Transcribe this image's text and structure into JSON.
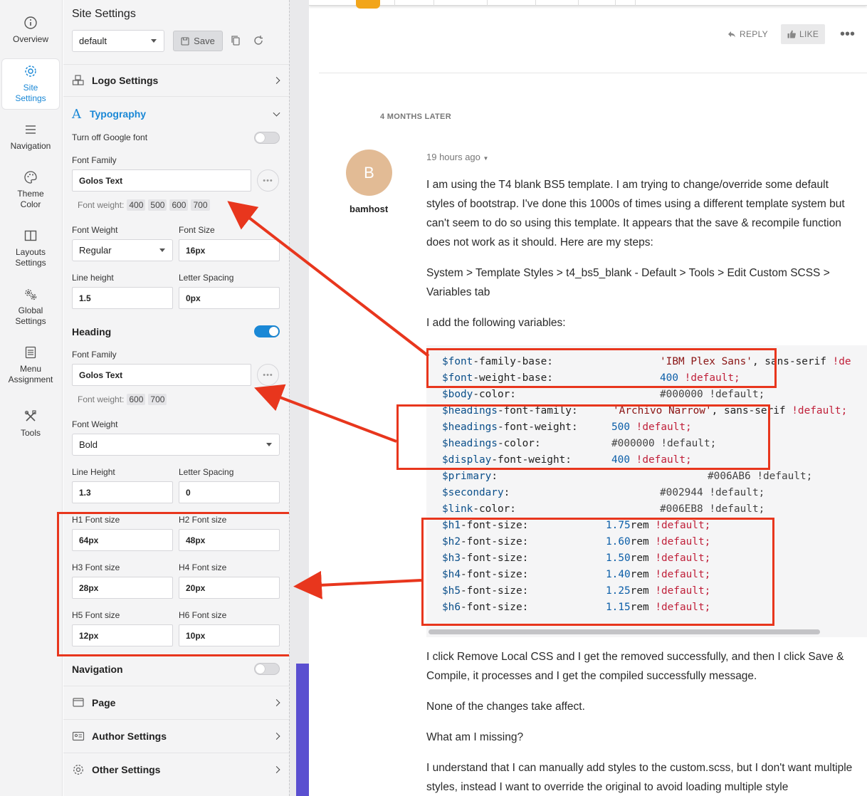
{
  "rail": {
    "items": [
      {
        "label": "Overview",
        "icon": "info-icon"
      },
      {
        "label": "Site\nSettings",
        "icon": "gear-icon"
      },
      {
        "label": "Navigation",
        "icon": "menu-icon"
      },
      {
        "label": "Theme\nColor",
        "icon": "palette-icon"
      },
      {
        "label": "Layouts\nSettings",
        "icon": "layout-icon"
      },
      {
        "label": "Global\nSettings",
        "icon": "gears-icon"
      },
      {
        "label": "Menu\nAssignment",
        "icon": "list-icon"
      },
      {
        "label": "Tools",
        "icon": "tools-icon"
      }
    ],
    "active_index": 1,
    "accent_color": "#1a88d6"
  },
  "panel": {
    "title": "Site Settings",
    "profile_select": "default",
    "save_label": "Save",
    "logo_settings": "Logo Settings",
    "typography": {
      "title": "Typography",
      "google_font_off_label": "Turn off Google font",
      "font_family_label": "Font Family",
      "font_family": "Golos Text",
      "font_weight_prefix": "Font weight:",
      "weights": [
        "400",
        "500",
        "600",
        "700"
      ],
      "font_weight_label": "Font Weight",
      "font_weight": "Regular",
      "font_size_label": "Font Size",
      "font_size": "16px",
      "line_height_label": "Line height",
      "line_height": "1.5",
      "letter_spacing_label": "Letter Spacing",
      "letter_spacing": "0px"
    },
    "heading": {
      "title": "Heading",
      "toggle_on": true,
      "font_family_label": "Font Family",
      "font_family": "Golos Text",
      "font_weight_prefix": "Font weight:",
      "weights": [
        "600",
        "700"
      ],
      "font_weight_label": "Font Weight",
      "font_weight": "Bold",
      "line_height_label": "Line Height",
      "line_height": "1.3",
      "letter_spacing_label": "Letter Spacing",
      "letter_spacing": "0",
      "h1_label": "H1 Font size",
      "h1": "64px",
      "h2_label": "H2 Font size",
      "h2": "48px",
      "h3_label": "H3 Font size",
      "h3": "28px",
      "h4_label": "H4 Font size",
      "h4": "20px",
      "h5_label": "H5 Font size",
      "h5": "12px",
      "h6_label": "H6 Font size",
      "h6": "10px"
    },
    "navigation_label": "Navigation",
    "page_label": "Page",
    "author_settings_label": "Author Settings",
    "other_settings_label": "Other Settings"
  },
  "post": {
    "reply_label": "REPLY",
    "like_label": "LIKE",
    "time_gap": "4 MONTHS LATER",
    "avatar_letter": "B",
    "avatar_color": "#e2bb95",
    "username": "bamhost",
    "post_time": "19 hours ago",
    "p1": "I am using the T4 blank BS5 template. I am trying to change/override some default styles of bootstrap. I've done this 1000s of times using a different template system but can't seem to do so using this template. It appears that the save & recompile function does not work as it should. Here are my steps:",
    "p2": "System > Template Styles > t4_bs5_blank - Default > Tools > Edit Custom SCSS > Variables tab",
    "p3": "I add the following variables:",
    "p4": "I click Remove Local CSS and I get the removed successfully, and then I click Save & Compile, it processes and I get the compiled successfully message.",
    "p5": "None of the changes take affect.",
    "p6": "What am I missing?",
    "p7": "I understand that I can manually add styles to the custom.scss, but I don't want multiple styles, instead I want to override the original to avoid loading multiple style"
  },
  "code_lines": [
    {
      "var": "$font",
      "rest": "-family-base:",
      "val": "'IBM Plex Sans'",
      "tail": ", sans-serif !de"
    },
    {
      "var": "$font",
      "rest": "-weight-base:",
      "val": "400",
      "tail": " !default;"
    },
    {
      "var": "$body",
      "rest": "-color:",
      "val": "#000000",
      "tail": " !default;"
    },
    {
      "var": "$headings",
      "rest": "-font-family:",
      "val": "'Archivo Narrow'",
      "tail": ", sans-serif !default;"
    },
    {
      "var": "$headings",
      "rest": "-font-weight:",
      "val": "500",
      "tail": " !default;"
    },
    {
      "var": "$headings",
      "rest": "-color:",
      "val": "#000000",
      "tail": " !default;"
    },
    {
      "var": "$display",
      "rest": "-font-weight:",
      "val": "400",
      "tail": " !default;"
    },
    {
      "var": "$primary",
      "rest": ":",
      "val": "#006AB6",
      "tail": " !default;"
    },
    {
      "var": "$secondary",
      "rest": ":",
      "val": "#002944",
      "tail": " !default;"
    },
    {
      "var": "$link",
      "rest": "-color:",
      "val": "#006EB8",
      "tail": " !default;"
    },
    {
      "var": "$h1",
      "rest": "-font-size:",
      "val": "1.75",
      "tail": "rem !default;"
    },
    {
      "var": "$h2",
      "rest": "-font-size:",
      "val": "1.60",
      "tail": "rem !default;"
    },
    {
      "var": "$h3",
      "rest": "-font-size:",
      "val": "1.50",
      "tail": "rem !default;"
    },
    {
      "var": "$h4",
      "rest": "-font-size:",
      "val": "1.40",
      "tail": "rem !default;"
    },
    {
      "var": "$h5",
      "rest": "-font-size:",
      "val": "1.25",
      "tail": "rem !default;"
    },
    {
      "var": "$h6",
      "rest": "-font-size:",
      "val": "1.15",
      "tail": "rem !default;"
    }
  ],
  "annotation_color": "#e8361d"
}
